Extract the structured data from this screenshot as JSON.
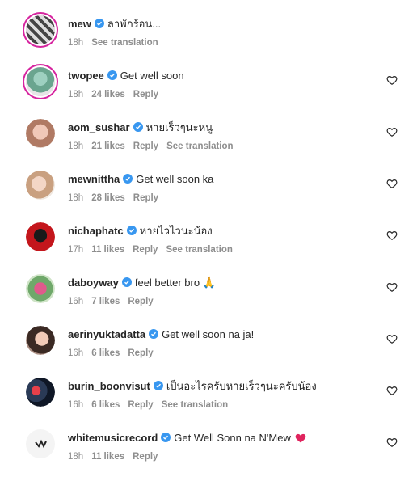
{
  "comments": [
    {
      "username": "mew",
      "text": "ลาพักร้อน...",
      "time": "18h",
      "likes": "",
      "reply": "",
      "translation": "See translation",
      "has_heart": false,
      "story_ring": true
    },
    {
      "username": "twopee",
      "text": "Get well soon",
      "time": "18h",
      "likes": "24 likes",
      "reply": "Reply",
      "translation": "",
      "has_heart": true,
      "story_ring": true
    },
    {
      "username": "aom_sushar",
      "text": "หายเร็วๆนะหนู",
      "time": "18h",
      "likes": "21 likes",
      "reply": "Reply",
      "translation": "See translation",
      "has_heart": true,
      "story_ring": false
    },
    {
      "username": "mewnittha",
      "text": "Get well soon ka",
      "time": "18h",
      "likes": "28 likes",
      "reply": "Reply",
      "translation": "",
      "has_heart": true,
      "story_ring": false
    },
    {
      "username": "nichaphatc",
      "text": "หายไวไวนะน้อง",
      "time": "17h",
      "likes": "11 likes",
      "reply": "Reply",
      "translation": "See translation",
      "has_heart": true,
      "story_ring": false
    },
    {
      "username": "daboyway",
      "text": "feel better bro 🙏",
      "time": "16h",
      "likes": "7 likes",
      "reply": "Reply",
      "translation": "",
      "has_heart": true,
      "story_ring": false
    },
    {
      "username": "aerinyuktadatta",
      "text": "Get well soon na ja!",
      "time": "16h",
      "likes": "6 likes",
      "reply": "Reply",
      "translation": "",
      "has_heart": true,
      "story_ring": false
    },
    {
      "username": "burin_boonvisut",
      "text": "เป็นอะไรครับหายเร็วๆนะครับน้อง",
      "time": "16h",
      "likes": "6 likes",
      "reply": "Reply",
      "translation": "See translation",
      "has_heart": true,
      "story_ring": false
    },
    {
      "username": "whitemusicrecord",
      "text": "Get Well Sonn na N'Mew",
      "time": "18h",
      "likes": "11 likes",
      "reply": "Reply",
      "translation": "",
      "has_heart": true,
      "story_ring": false
    }
  ],
  "colors": {
    "text": "#262626",
    "meta": "#8e8e8e",
    "verified": "#3897f0",
    "ring": "#d6249f"
  }
}
